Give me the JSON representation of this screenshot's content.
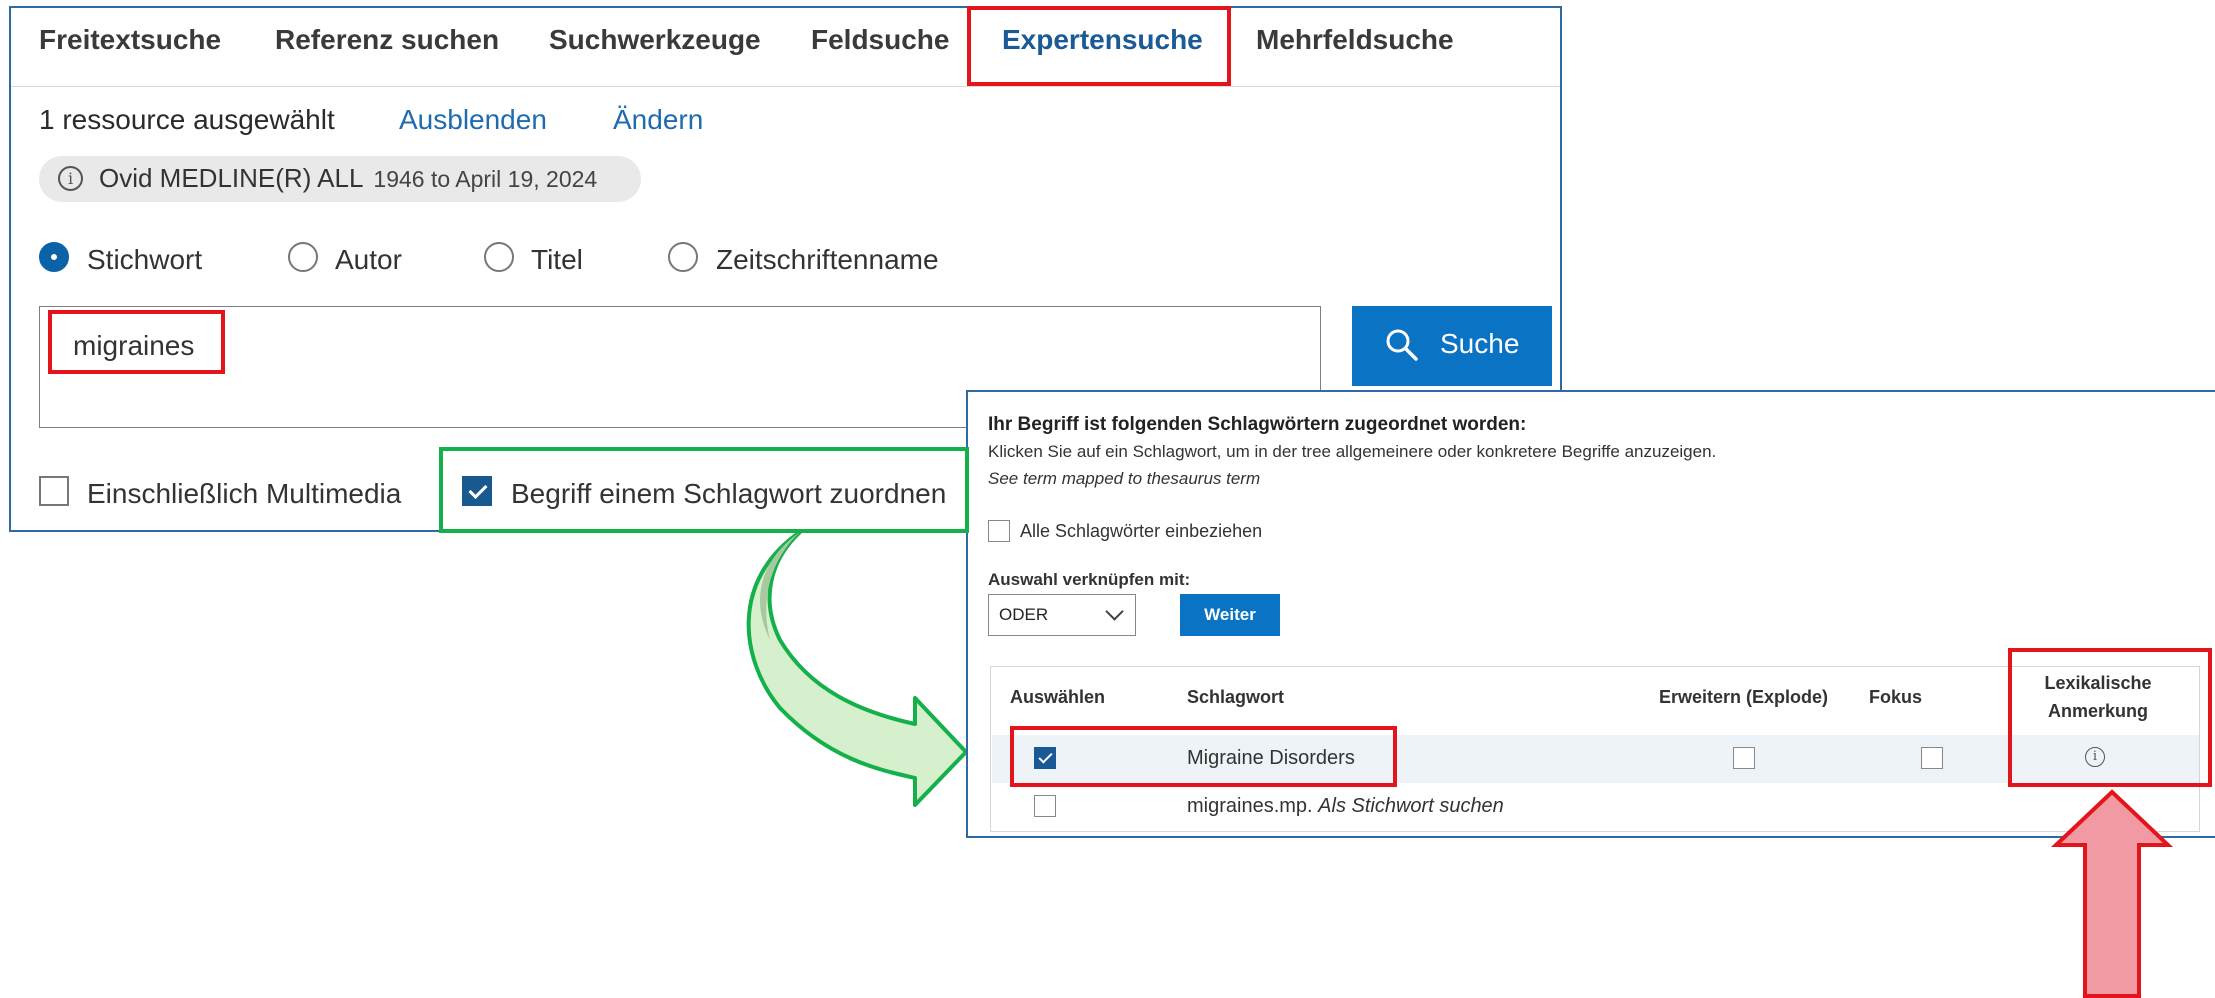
{
  "colors": {
    "accent": "#0b73c3",
    "active_tab": "#1a5a96",
    "highlight_red": "#e3141b",
    "highlight_green": "#14b04a",
    "arrow_pink": "#f29aa3"
  },
  "tabs": [
    "Freitextsuche",
    "Referenz suchen",
    "Suchwerkzeuge",
    "Feldsuche",
    "Expertensuche",
    "Mehrfeldsuche"
  ],
  "active_tab": "Expertensuche",
  "resources": {
    "selected_text": "1 ressource ausgewählt",
    "hide_link": "Ausblenden",
    "change_link": "Ändern",
    "database": "Ovid MEDLINE(R) ALL",
    "range": "1946 to April 19, 2024"
  },
  "search_fields": {
    "options": [
      "Stichwort",
      "Autor",
      "Titel",
      "Zeitschriftenname"
    ],
    "selected": "Stichwort"
  },
  "query": {
    "value": "migraines"
  },
  "search_button": {
    "label": "Suche"
  },
  "options": {
    "multimedia_label": "Einschließlich Multimedia",
    "multimedia_checked": false,
    "map_term_label": "Begriff einem Schlagwort zuordnen",
    "map_term_checked": true
  },
  "mapping": {
    "title": "Ihr Begriff ist folgenden Schlagwörtern zugeordnet worden:",
    "help": "Klicken Sie auf ein Schlagwort, um in der tree allgemeinere oder konkretere Begriffe anzuzeigen.",
    "see_term": "See term mapped to thesaurus term",
    "include_all_label": "Alle Schlagwörter einbeziehen",
    "combine_label": "Auswahl verknüpfen mit:",
    "combine_value": "ODER",
    "continue_button": "Weiter",
    "headers": {
      "select": "Auswählen",
      "subject": "Schlagwort",
      "explode": "Erweitern (Explode)",
      "focus": "Fokus",
      "scope_note_1": "Lexikalische",
      "scope_note_2": "Anmerkung"
    },
    "rows": [
      {
        "term": "Migraine Disorders",
        "checked": true
      },
      {
        "term": "migraines.mp.",
        "suffix": "Als Stichwort suchen",
        "checked": false
      }
    ]
  }
}
